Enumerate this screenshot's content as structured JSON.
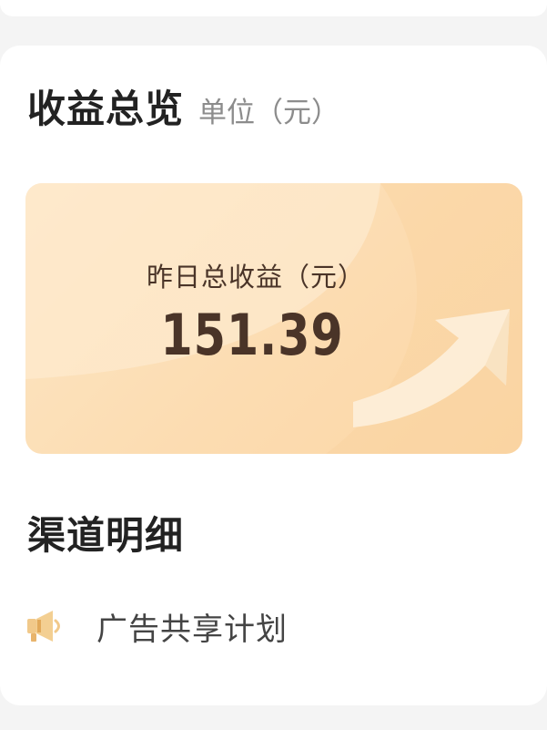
{
  "overview": {
    "title": "收益总览",
    "unit": "单位（元）"
  },
  "banner": {
    "label": "昨日总收益（元）",
    "value": "151.39"
  },
  "channels": {
    "title": "渠道明细",
    "items": [
      {
        "label": "广告共享计划",
        "icon": "megaphone-icon"
      }
    ]
  },
  "colors": {
    "banner_bg": "#fcdcb1",
    "banner_text": "#4a3428",
    "icon_accent": "#f1c98a"
  }
}
